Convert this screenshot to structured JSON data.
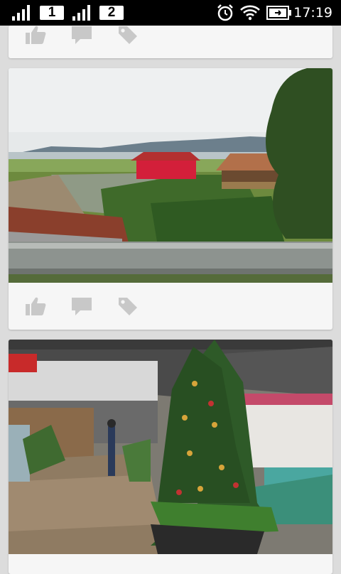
{
  "status_bar": {
    "sim1_label": "1",
    "sim2_label": "2",
    "time": "17:19",
    "icons": [
      "signal-icon",
      "signal-icon",
      "alarm-clock-icon",
      "wifi-icon",
      "battery-charging-icon"
    ]
  },
  "feed": {
    "posts": [
      {
        "image": "partial-photo-above",
        "actions": [
          "like-icon",
          "comment-icon",
          "tag-icon"
        ]
      },
      {
        "image": "lake-floating-houses-photo",
        "actions": [
          "like-icon",
          "comment-icon",
          "tag-icon"
        ]
      },
      {
        "image": "christmas-tree-porch-photo",
        "actions": []
      }
    ]
  },
  "colors": {
    "background": "#dcdcdc",
    "card": "#f6f6f6",
    "icon": "#c8c8c8",
    "status_bar": "#000000"
  }
}
